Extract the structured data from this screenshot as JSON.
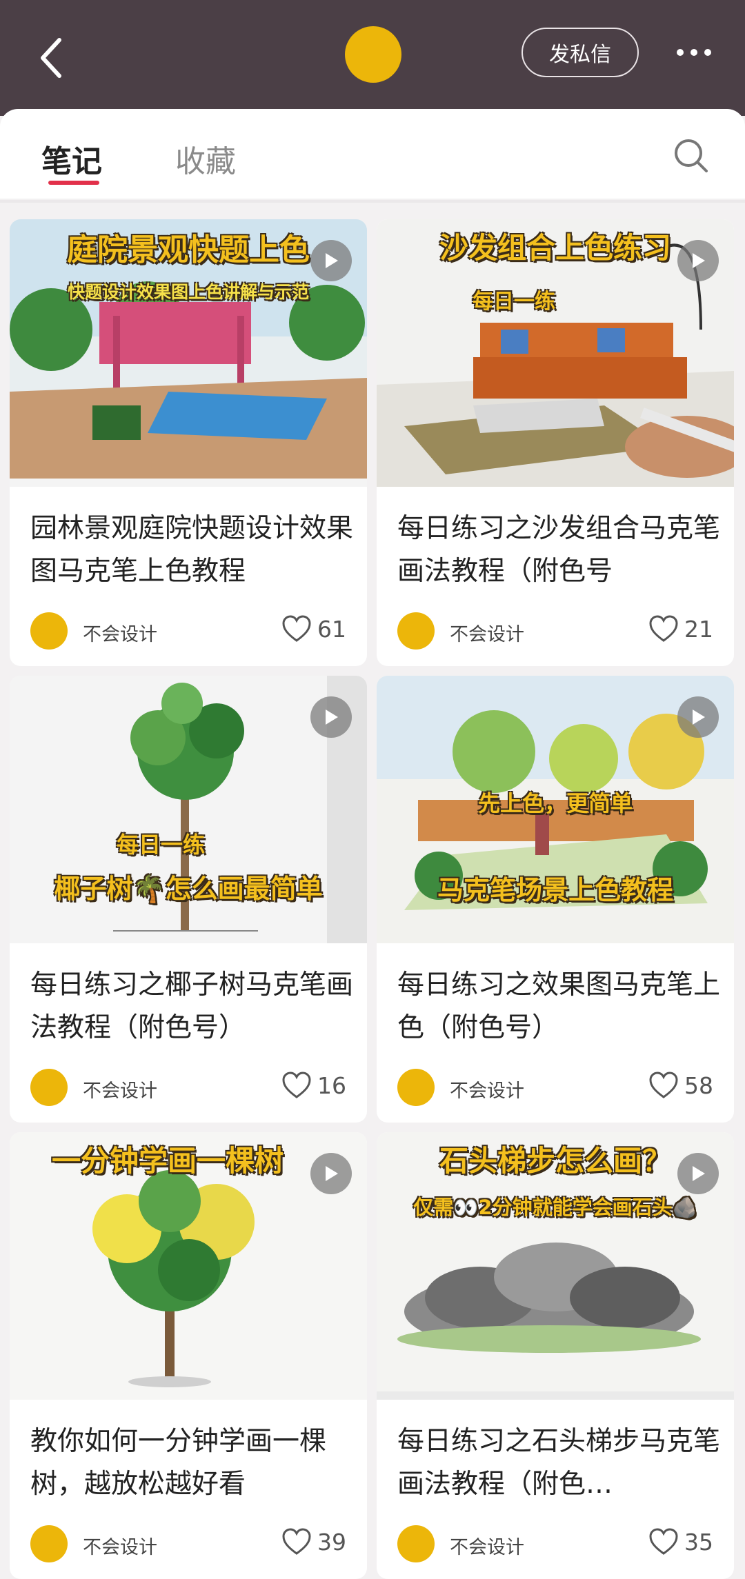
{
  "header": {
    "dm_label": "发私信"
  },
  "tabs": {
    "notes": "笔记",
    "collections": "收藏"
  },
  "cards": [
    {
      "overlay1": "庭院景观快题上色",
      "overlay2": "快题设计效果图上色讲解与示范",
      "title": "园林景观庭院快题设计效果图马克笔上色教程",
      "author": "不会设计",
      "likes": "61"
    },
    {
      "overlay1": "沙发组合上色练习",
      "overlay2": "每日一练",
      "title": "每日练习之沙发组合马克笔画法教程（附色号",
      "author": "不会设计",
      "likes": "21"
    },
    {
      "overlay1": "每日一练",
      "overlay2": "椰子树🌴怎么画最简单",
      "title": "每日练习之椰子树马克笔画法教程（附色号）",
      "author": "不会设计",
      "likes": "16"
    },
    {
      "overlay1": "先上色，更简单",
      "overlay2": "马克笔场景上色教程",
      "title": "每日练习之效果图马克笔上色（附色号）",
      "author": "不会设计",
      "likes": "58"
    },
    {
      "overlay1": "一分钟学画一棵树",
      "overlay2": "",
      "title": "教你如何一分钟学画一棵树，越放松越好看",
      "author": "不会设计",
      "likes": "39"
    },
    {
      "overlay1": "石头梯步怎么画？",
      "overlay2": "仅需👀2分钟就能学会画石头🪨",
      "title": "每日练习之石头梯步马克笔画法教程（附色…",
      "author": "不会设计",
      "likes": "35"
    }
  ]
}
